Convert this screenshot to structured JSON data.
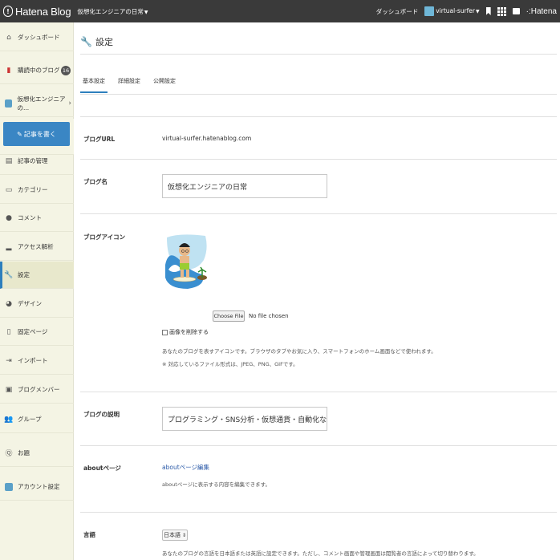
{
  "topbar": {
    "logo_text": "Hatena Blog",
    "blog_name": "仮想化エンジニアの日常",
    "dashboard": "ダッシュボード",
    "username": "virtual-surfer",
    "hatena": "Hatena"
  },
  "sidebar": {
    "items": [
      {
        "label": "ダッシュボード",
        "icon": "home-icon"
      },
      {
        "label": "購読中のブログ",
        "icon": "bookmark-icon",
        "badge": "16"
      },
      {
        "label": "仮想化エンジニアの...",
        "icon": "blog-avatar"
      },
      {
        "label": "記事の管理",
        "icon": "document-icon"
      },
      {
        "label": "カテゴリー",
        "icon": "folder-icon"
      },
      {
        "label": "コメント",
        "icon": "comment-icon"
      },
      {
        "label": "アクセス解析",
        "icon": "chart-icon"
      },
      {
        "label": "設定",
        "icon": "wrench-icon"
      },
      {
        "label": "デザイン",
        "icon": "palette-icon"
      },
      {
        "label": "固定ページ",
        "icon": "page-icon"
      },
      {
        "label": "インポート",
        "icon": "import-icon"
      },
      {
        "label": "ブログメンバー",
        "icon": "members-icon"
      },
      {
        "label": "グループ",
        "icon": "group-icon"
      },
      {
        "label": "お題",
        "icon": "topic-icon"
      },
      {
        "label": "アカウント設定",
        "icon": "account-icon"
      }
    ],
    "write_button": "記事を書く"
  },
  "main": {
    "title": "設定",
    "tabs": [
      {
        "label": "基本設定",
        "active": true
      },
      {
        "label": "詳細設定",
        "active": false
      },
      {
        "label": "公開設定",
        "active": false
      }
    ],
    "blog_url_label": "ブログURL",
    "blog_url_value": "virtual-surfer.hatenablog.com",
    "blog_name_label": "ブログ名",
    "blog_name_value": "仮想化エンジニアの日常",
    "blog_icon_label": "ブログアイコン",
    "file_button": "Choose File",
    "file_none": "No file chosen",
    "delete_image": "画像を削除する",
    "icon_note1": "あなたのブログを表すアイコンです。ブラウザのタブやお気に入り、スマートフォンのホーム画面などで使われます。",
    "icon_note2": "※ 対応しているファイル形式は、JPEG、PNG、GIFです。",
    "description_label": "ブログの説明",
    "description_value": "プログラミング・SNS分析・仮想通貨・自動化などに関してよ",
    "about_label": "aboutページ",
    "about_link": "aboutページ編集",
    "about_note": "aboutページに表示する内容を編集できます。",
    "language_label": "言語",
    "language_value": "日本語",
    "language_note": "あなたのブログの言語を日本語または英語に設定できます。ただし、コメント画面や管理画面は閲覧者の言語によって切り替わります。"
  }
}
